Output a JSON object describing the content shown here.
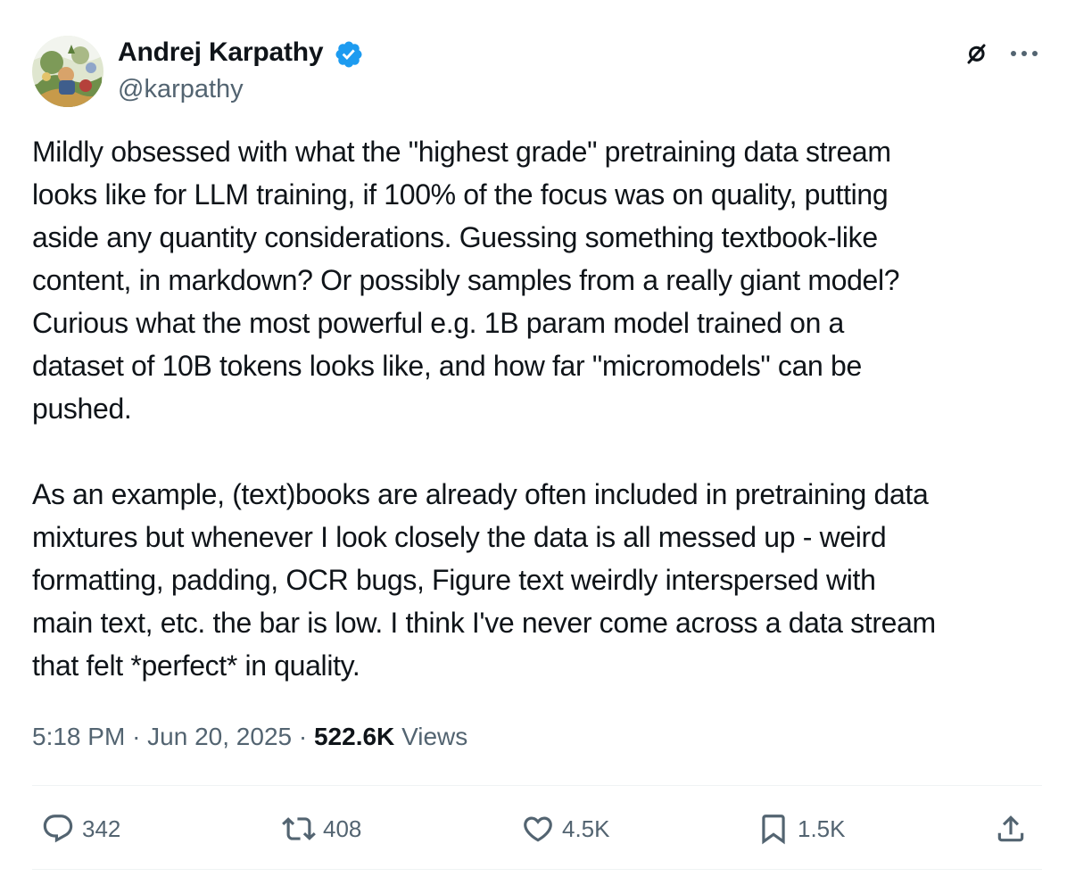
{
  "author": {
    "name": "Andrej Karpathy",
    "handle": "@karpathy",
    "verified": true
  },
  "icons": {
    "avatar": "profile-picture",
    "verified": "verified-badge-icon",
    "grok": "grok-icon",
    "more": "more-icon",
    "reply": "reply-icon",
    "repost": "repost-icon",
    "like": "heart-icon",
    "bookmark": "bookmark-icon",
    "share": "share-icon"
  },
  "colors": {
    "text": "#0f1419",
    "secondary": "#536471",
    "verified": "#1d9bf0",
    "divider": "#eff3f4"
  },
  "tweet": {
    "paragraphs": [
      "Mildly obsessed with what the \"highest grade\" pretraining data stream\nlooks like for LLM training, if 100% of the focus was on quality, putting\naside any quantity considerations. Guessing something textbook-like\ncontent, in markdown? Or possibly samples from a really giant model?\nCurious what the most powerful e.g. 1B param model trained on a\ndataset of 10B tokens looks like, and how far \"micromodels\" can be\npushed.",
      "As an example, (text)books are already often included in pretraining data\nmixtures but whenever I look closely the data is all messed up - weird\nformatting, padding, OCR bugs, Figure text weirdly interspersed with\nmain text, etc. the bar is low. I think I've never come across a data stream\nthat felt *perfect* in quality."
    ],
    "time": "5:18 PM",
    "separator": "·",
    "date": "Jun 20, 2025",
    "views_count": "522.6K",
    "views_label": "Views"
  },
  "actions": {
    "replies": "342",
    "reposts": "408",
    "likes": "4.5K",
    "bookmarks": "1.5K"
  }
}
